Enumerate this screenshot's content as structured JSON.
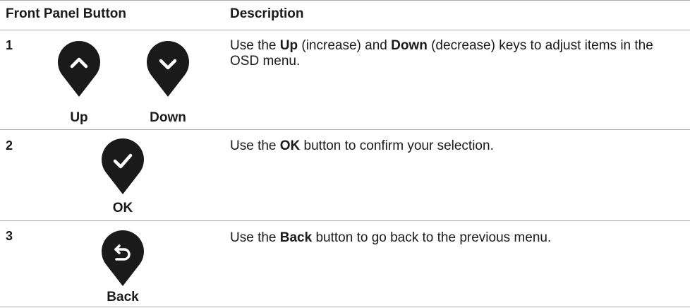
{
  "header": {
    "col1": "Front Panel Button",
    "col2": "Description"
  },
  "rows": [
    {
      "number": "1",
      "buttons": [
        {
          "label": "Up",
          "icon": "chevron-up-icon"
        },
        {
          "label": "Down",
          "icon": "chevron-down-icon"
        }
      ],
      "desc": {
        "p1": "Use the ",
        "b1": "Up",
        "p2": " (increase) and ",
        "b2": "Down",
        "p3": " (decrease) keys to adjust items in the OSD menu."
      }
    },
    {
      "number": "2",
      "buttons": [
        {
          "label": "OK",
          "icon": "checkmark-icon"
        }
      ],
      "desc": {
        "p1": "Use the ",
        "b1": "OK",
        "p2": " button to confirm your selection."
      }
    },
    {
      "number": "3",
      "buttons": [
        {
          "label": "Back",
          "icon": "back-arrow-icon"
        }
      ],
      "desc": {
        "p1": "Use the ",
        "b1": "Back",
        "p2": " button to go back to the previous menu."
      }
    }
  ],
  "colors": {
    "pin": "#1a1a1a",
    "rule": "#a8a8a8"
  }
}
